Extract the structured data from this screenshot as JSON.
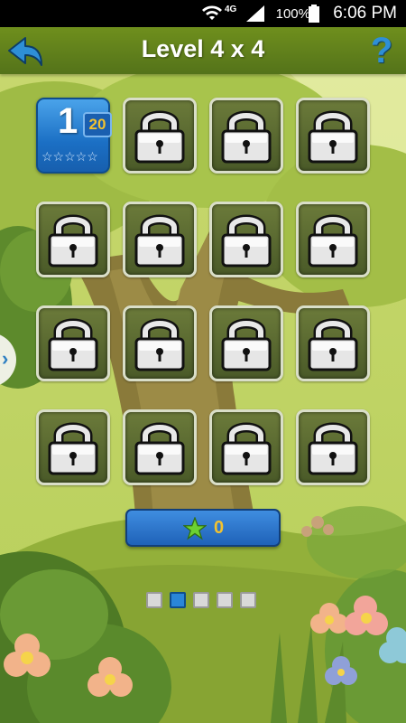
{
  "status_bar": {
    "network": "4G",
    "battery": "100%",
    "time": "6:06 PM"
  },
  "header": {
    "title": "Level 4 x 4",
    "back_icon": "back-arrow-icon",
    "help_label": "?"
  },
  "levels": [
    {
      "number": "1",
      "moves": "20",
      "stars": "☆☆☆☆☆",
      "locked": false
    },
    {
      "locked": true
    },
    {
      "locked": true
    },
    {
      "locked": true
    },
    {
      "locked": true
    },
    {
      "locked": true
    },
    {
      "locked": true
    },
    {
      "locked": true
    },
    {
      "locked": true
    },
    {
      "locked": true
    },
    {
      "locked": true
    },
    {
      "locked": true
    },
    {
      "locked": true
    },
    {
      "locked": true
    },
    {
      "locked": true
    },
    {
      "locked": true
    }
  ],
  "score": {
    "value": "0",
    "icon": "green-star-icon"
  },
  "side_arrow": "›",
  "pagination": {
    "count": 5,
    "active_index": 1
  },
  "colors": {
    "header": "#6f8f1d",
    "tile_blue": "#2a86d8",
    "score_text": "#f2c230",
    "star_green": "#6cd132"
  }
}
